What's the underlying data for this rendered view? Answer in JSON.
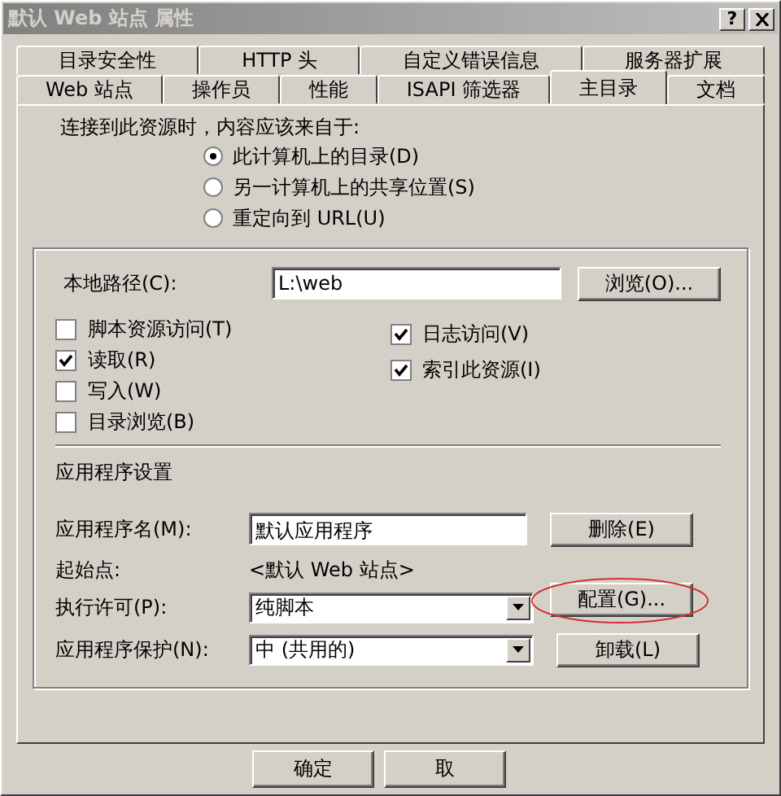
{
  "window": {
    "title": "默认 Web 站点 属性",
    "help": "?"
  },
  "tab_rows": [
    [
      {
        "label": "目录安全性",
        "selected": false
      },
      {
        "label": "HTTP 头",
        "selected": false
      },
      {
        "label": "自定义错误信息",
        "selected": false
      },
      {
        "label": "服务器扩展",
        "selected": false
      }
    ],
    [
      {
        "label": "Web 站点",
        "selected": false
      },
      {
        "label": "操作员",
        "selected": false
      },
      {
        "label": "性能",
        "selected": false
      },
      {
        "label": "ISAPI 筛选器",
        "selected": false
      },
      {
        "label": "主目录",
        "selected": true
      },
      {
        "label": "文档",
        "selected": false
      }
    ]
  ],
  "source": {
    "label": "连接到此资源时，内容应该来自于:",
    "options": [
      {
        "label": "此计算机上的目录(D)",
        "selected": true
      },
      {
        "label": "另一计算机上的共享位置(S)",
        "selected": false
      },
      {
        "label": "重定向到 URL(U)",
        "selected": false
      }
    ]
  },
  "local_path": {
    "label": "本地路径(C):",
    "value": "L:\\web",
    "button": "浏览(O)..."
  },
  "permissions_left": [
    {
      "label": "脚本资源访问(T)",
      "checked": false
    },
    {
      "label": "读取(R)",
      "checked": true
    },
    {
      "label": "写入(W)",
      "checked": false
    },
    {
      "label": "目录浏览(B)",
      "checked": false
    }
  ],
  "permissions_right": [
    {
      "label": "日志访问(V)",
      "checked": true
    },
    {
      "label": "索引此资源(I)",
      "checked": true
    }
  ],
  "app_settings": {
    "heading": "应用程序设置",
    "name": {
      "label": "应用程序名(M):",
      "value": "默认应用程序"
    },
    "delete_button": "删除(E)",
    "start_point": {
      "label": "起始点:",
      "value": "<默认 Web 站点>"
    },
    "configure_button": "配置(G)...",
    "execute": {
      "label": "执行许可(P):",
      "value": "纯脚本"
    },
    "protection": {
      "label": "应用程序保护(N):",
      "value": "中 (共用的)"
    },
    "unload_button": "卸载(L)"
  },
  "buttons": [
    "确定",
    "取"
  ]
}
